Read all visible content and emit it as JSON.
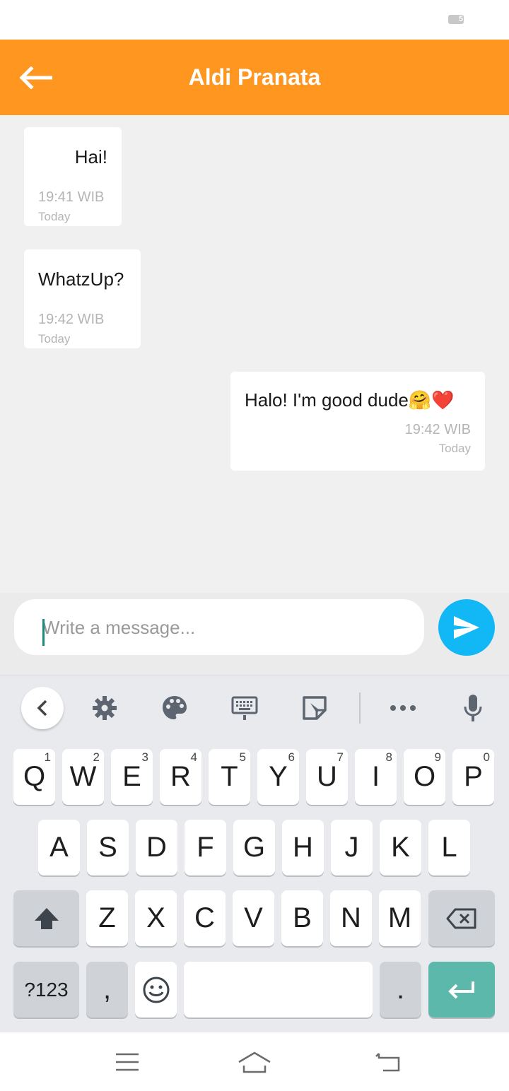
{
  "status_bar": {
    "battery_level": "5"
  },
  "header": {
    "title": "Aldi Pranata",
    "back_icon": "arrow-left-icon"
  },
  "messages": [
    {
      "text": "Hai!",
      "time": "19:41 WIB",
      "day": "Today",
      "side": "left"
    },
    {
      "text": "WhatzUp?",
      "time": "19:42 WIB",
      "day": "Today",
      "side": "left"
    },
    {
      "text": "Halo! I'm good dude🤗❤️",
      "time": "19:42 WIB",
      "day": "Today",
      "side": "right"
    }
  ],
  "composer": {
    "placeholder": "Write a message...",
    "value": "",
    "send_icon": "send-icon"
  },
  "keyboard": {
    "toolbar": [
      "chevron-left-icon",
      "gear-icon",
      "palette-icon",
      "keyboard-icon",
      "sticker-icon",
      "more-icon",
      "microphone-icon"
    ],
    "row1": [
      {
        "label": "Q",
        "hint": "1"
      },
      {
        "label": "W",
        "hint": "2"
      },
      {
        "label": "E",
        "hint": "3"
      },
      {
        "label": "R",
        "hint": "4"
      },
      {
        "label": "T",
        "hint": "5"
      },
      {
        "label": "Y",
        "hint": "6"
      },
      {
        "label": "U",
        "hint": "7"
      },
      {
        "label": "I",
        "hint": "8"
      },
      {
        "label": "O",
        "hint": "9"
      },
      {
        "label": "P",
        "hint": "0"
      }
    ],
    "row2": [
      "A",
      "S",
      "D",
      "F",
      "G",
      "H",
      "J",
      "K",
      "L"
    ],
    "row3": [
      "Z",
      "X",
      "C",
      "V",
      "B",
      "N",
      "M"
    ],
    "symbols_label": "?123",
    "comma_label": ",",
    "period_label": ".",
    "shift_icon": "shift-icon",
    "backspace_icon": "backspace-icon",
    "emoji_icon": "emoji-icon",
    "enter_icon": "enter-icon"
  },
  "nav": [
    "menu-icon",
    "home-icon",
    "back-icon"
  ],
  "colors": {
    "accent": "#ff9620",
    "send": "#12b8f5",
    "enter": "#5cb8aa"
  }
}
